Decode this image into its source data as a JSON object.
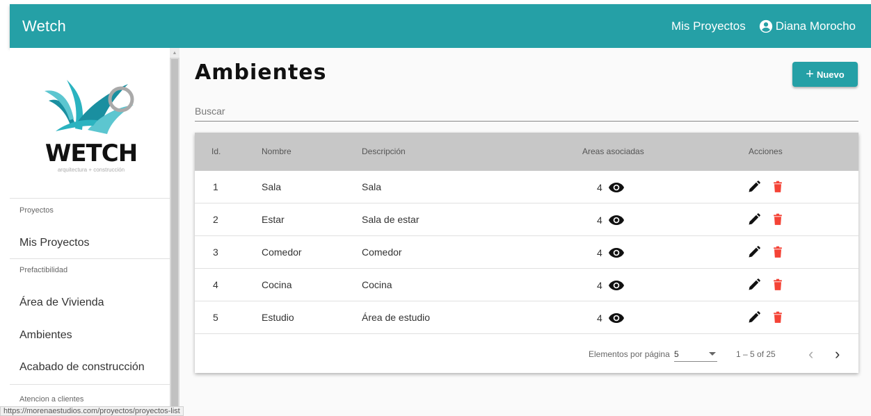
{
  "app": {
    "brand": "Wetch",
    "nav_link": "Mis Proyectos",
    "user_name": "Diana Morocho",
    "accent_color": "#25a0a6"
  },
  "sidebar": {
    "logo_text": "WETCH",
    "logo_subtitle": "arquitectura + construcción",
    "sections": [
      {
        "label": "Proyectos",
        "items": [
          "Mis Proyectos"
        ]
      },
      {
        "label": "Prefactibilidad",
        "items": [
          "Área de Vivienda",
          "Ambientes",
          "Acabado de construcción"
        ]
      },
      {
        "label": "Atencion a clientes",
        "items": []
      }
    ]
  },
  "status_bar": {
    "url": "https://morenaestudios.com/proyectos/proyectos-list"
  },
  "page": {
    "title": "Ambientes",
    "new_button": "Nuevo",
    "search_placeholder": "Buscar"
  },
  "table": {
    "headers": [
      "Id.",
      "Nombre",
      "Descripción",
      "Areas asociadas",
      "Acciones"
    ],
    "rows": [
      {
        "id": "1",
        "nombre": "Sala",
        "descripcion": "Sala",
        "areas": "4"
      },
      {
        "id": "2",
        "nombre": "Estar",
        "descripcion": "Sala de estar",
        "areas": "4"
      },
      {
        "id": "3",
        "nombre": "Comedor",
        "descripcion": "Comedor",
        "areas": "4"
      },
      {
        "id": "4",
        "nombre": "Cocina",
        "descripcion": "Cocina",
        "areas": "4"
      },
      {
        "id": "5",
        "nombre": "Estudio",
        "descripcion": "Área de estudio",
        "areas": "4"
      }
    ],
    "icons": {
      "view": "eye-icon",
      "edit": "pencil-icon",
      "delete": "trash-icon"
    },
    "delete_color": "#f44336"
  },
  "paginator": {
    "label": "Elementos por página",
    "page_size": "5",
    "range": "1 – 5 of 25"
  }
}
